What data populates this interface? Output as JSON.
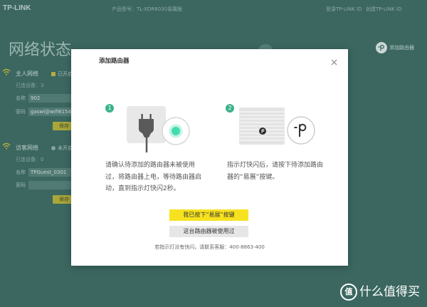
{
  "header": {
    "logo": "TP-LINK",
    "product_model": "产品型号：TL-XDR6030易展版",
    "login_link": "登录TP-LINK ID",
    "create_link": "创建TP-LINK ID"
  },
  "page_title": "网络状态",
  "add_router_shortcut": {
    "label": "添加路由器",
    "icon": "yizhan-p-icon"
  },
  "host_network": {
    "icon": "wifi-icon",
    "title": "主人网络",
    "status": "已开启",
    "connected": "已连设备：3",
    "name_label": "名称",
    "name_value": "902",
    "password_label": "密码",
    "password_value": "gaswl@wifi6154",
    "save_label": "保存"
  },
  "guest_network": {
    "icon": "wifi-icon",
    "title": "访客网络",
    "status": "未开启",
    "connected": "已连设备：0",
    "name_label": "名称",
    "name_value": "TPGuest_0301",
    "password_label": "密码",
    "password_value": "",
    "save_label": "保存"
  },
  "modal": {
    "title": "添加路由器",
    "close_icon": "close-icon",
    "steps": [
      {
        "number": "1",
        "illustration": "power-plug-outlet-illustration",
        "lines": [
          "请确认待添加的路由器未被使用",
          "过，将路由器上电，等待路由器启",
          "动，直到指示灯快闪2秒。"
        ]
      },
      {
        "number": "2",
        "illustration": "router-yizhan-button-illustration",
        "lines": [
          "指示灯快闪后，请按下待添加路由",
          "器的“易展”按键。"
        ]
      }
    ],
    "confirm_button": "我已按下“易展”按键",
    "used_button": "这台路由器被使用过",
    "footer": "若指示灯没有快闪，请联系客服：400-8863-400"
  },
  "watermark": {
    "badge": "值",
    "text": "什么值得买"
  },
  "colors": {
    "page_overlay": "#3b6760",
    "modal_bg": "#ffffff",
    "step_green": "#3db38a",
    "indicator_green": "#43dcae",
    "primary_button": "#f7e21f",
    "secondary_button": "#e6e6e6",
    "dim_yellow": "#aaa63a"
  }
}
